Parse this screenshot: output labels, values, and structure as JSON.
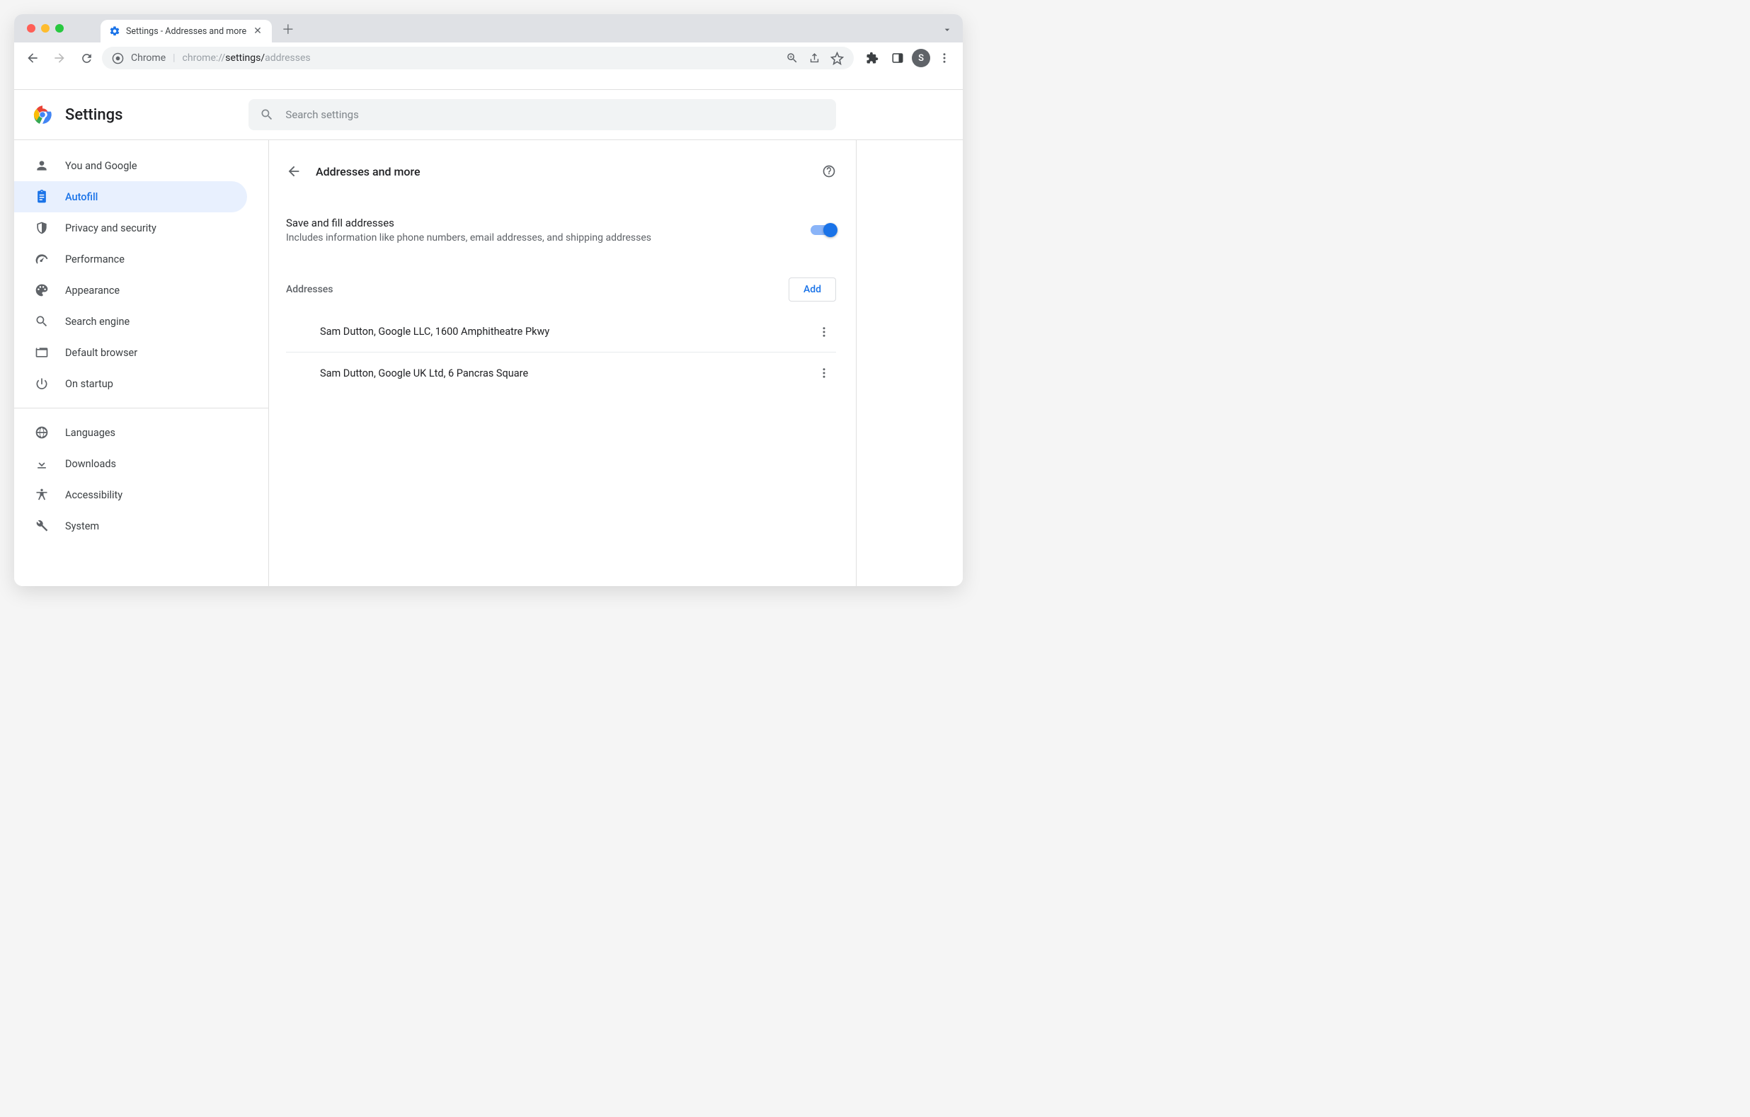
{
  "tab": {
    "title": "Settings - Addresses and more"
  },
  "url": {
    "scheme": "Chrome",
    "prefix": "chrome://",
    "path_bold": "settings/",
    "path_dim": "addresses"
  },
  "avatar_initial": "S",
  "settings_title": "Settings",
  "search": {
    "placeholder": "Search settings"
  },
  "sidebar": {
    "items": [
      {
        "label": "You and Google"
      },
      {
        "label": "Autofill"
      },
      {
        "label": "Privacy and security"
      },
      {
        "label": "Performance"
      },
      {
        "label": "Appearance"
      },
      {
        "label": "Search engine"
      },
      {
        "label": "Default browser"
      },
      {
        "label": "On startup"
      }
    ],
    "items2": [
      {
        "label": "Languages"
      },
      {
        "label": "Downloads"
      },
      {
        "label": "Accessibility"
      },
      {
        "label": "System"
      }
    ]
  },
  "page": {
    "title": "Addresses and more",
    "toggle": {
      "title": "Save and fill addresses",
      "subtitle": "Includes information like phone numbers, email addresses, and shipping addresses"
    },
    "section_title": "Addresses",
    "add_label": "Add",
    "addresses": [
      "Sam Dutton, Google LLC, 1600 Amphitheatre Pkwy",
      "Sam Dutton, Google UK Ltd, 6 Pancras Square"
    ]
  }
}
